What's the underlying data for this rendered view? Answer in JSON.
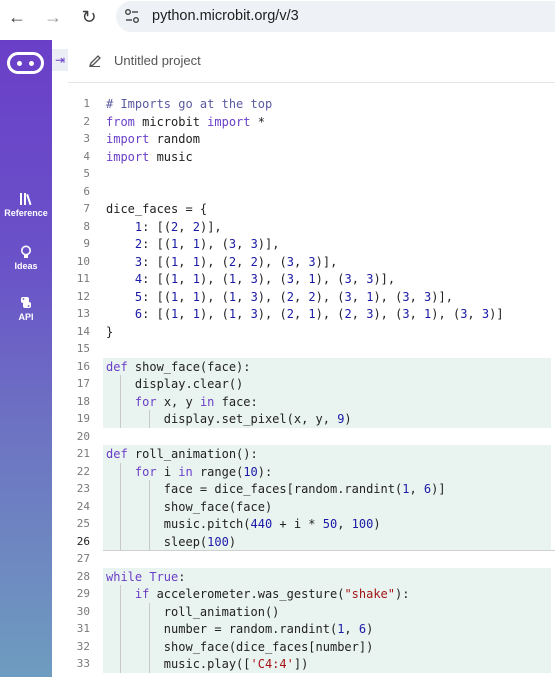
{
  "browser": {
    "url": "python.microbit.org/v/3",
    "back_icon": "arrow-left-icon",
    "forward_icon": "arrow-right-icon",
    "reload_icon": "reload-icon"
  },
  "sidebar": {
    "items": [
      {
        "label": "Reference",
        "icon": "books-icon"
      },
      {
        "label": "Ideas",
        "icon": "lightbulb-icon"
      },
      {
        "label": "API",
        "icon": "python-icon"
      }
    ]
  },
  "project": {
    "name": "Untitled project"
  },
  "editor": {
    "current_line": 26,
    "lines": [
      "# Imports go at the top",
      "from microbit import *",
      "import random",
      "import music",
      "",
      "",
      "dice_faces = {",
      "    1: [(2, 2)],",
      "    2: [(1, 1), (3, 3)],",
      "    3: [(1, 1), (2, 2), (3, 3)],",
      "    4: [(1, 1), (1, 3), (3, 1), (3, 3)],",
      "    5: [(1, 1), (1, 3), (2, 2), (3, 1), (3, 3)],",
      "    6: [(1, 1), (1, 3), (2, 1), (2, 3), (3, 1), (3, 3)]",
      "}",
      "",
      "def show_face(face):",
      "    display.clear()",
      "    for x, y in face:",
      "        display.set_pixel(x, y, 9)",
      "",
      "def roll_animation():",
      "    for i in range(10):",
      "        face = dice_faces[random.randint(1, 6)]",
      "        show_face(face)",
      "        music.pitch(440 + i * 50, 100)",
      "        sleep(100)",
      "",
      "while True:",
      "    if accelerometer.was_gesture(\"shake\"):",
      "        roll_animation()",
      "        number = random.randint(1, 6)",
      "        show_face(dice_faces[number])",
      "        music.play(['C4:4'])"
    ]
  },
  "colors": {
    "keyword": "#6a3fc8",
    "number": "#1a1aa6",
    "string": "#a31515",
    "block_highlight": "#e9f3f0",
    "sidebar_top": "#6a3fc8",
    "sidebar_bottom": "#6e9cc0"
  }
}
